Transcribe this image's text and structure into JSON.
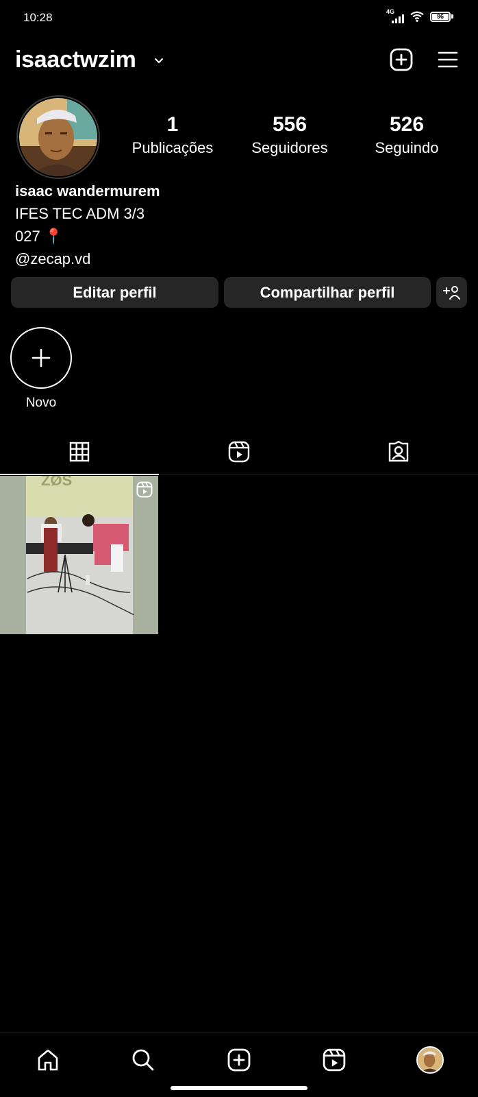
{
  "status_bar": {
    "time": "10:28",
    "network": "4G",
    "battery": "96",
    "icons": [
      "signal-icon",
      "wifi-icon",
      "battery-icon"
    ]
  },
  "header": {
    "username": "isaactwzim",
    "icons": [
      "chevron-down-icon",
      "create-post-icon",
      "menu-icon"
    ]
  },
  "profile": {
    "stats": [
      {
        "value": "1",
        "label": "Publicações"
      },
      {
        "value": "556",
        "label": "Seguidores"
      },
      {
        "value": "526",
        "label": "Seguindo"
      }
    ],
    "bio": {
      "name": "isaac wandermurem",
      "line1": "IFES TEC ADM 3/3",
      "line2": "027 📍",
      "mention": "@zecap.vd"
    }
  },
  "actions": {
    "edit_label": "Editar perfil",
    "share_label": "Compartilhar perfil",
    "discover_icon": "add-person-icon"
  },
  "highlights": [
    {
      "label": "Novo",
      "icon": "plus-icon"
    }
  ],
  "tabs": [
    {
      "name": "posts",
      "icon": "grid-icon",
      "active": true
    },
    {
      "name": "reels",
      "icon": "reels-icon",
      "active": false
    },
    {
      "name": "tagged",
      "icon": "tagged-icon",
      "active": false
    }
  ],
  "posts": [
    {
      "type": "reel",
      "banner_text": "ZØS",
      "icon": "reel-badge-icon"
    }
  ],
  "bottom_nav": [
    {
      "name": "home",
      "icon": "home-icon"
    },
    {
      "name": "search",
      "icon": "search-icon"
    },
    {
      "name": "create",
      "icon": "create-icon"
    },
    {
      "name": "reels",
      "icon": "reels-icon"
    },
    {
      "name": "profile",
      "icon": "profile-avatar"
    }
  ],
  "colors": {
    "background": "#000000",
    "button": "#262626",
    "text": "#ffffff",
    "divider": "#262626"
  }
}
